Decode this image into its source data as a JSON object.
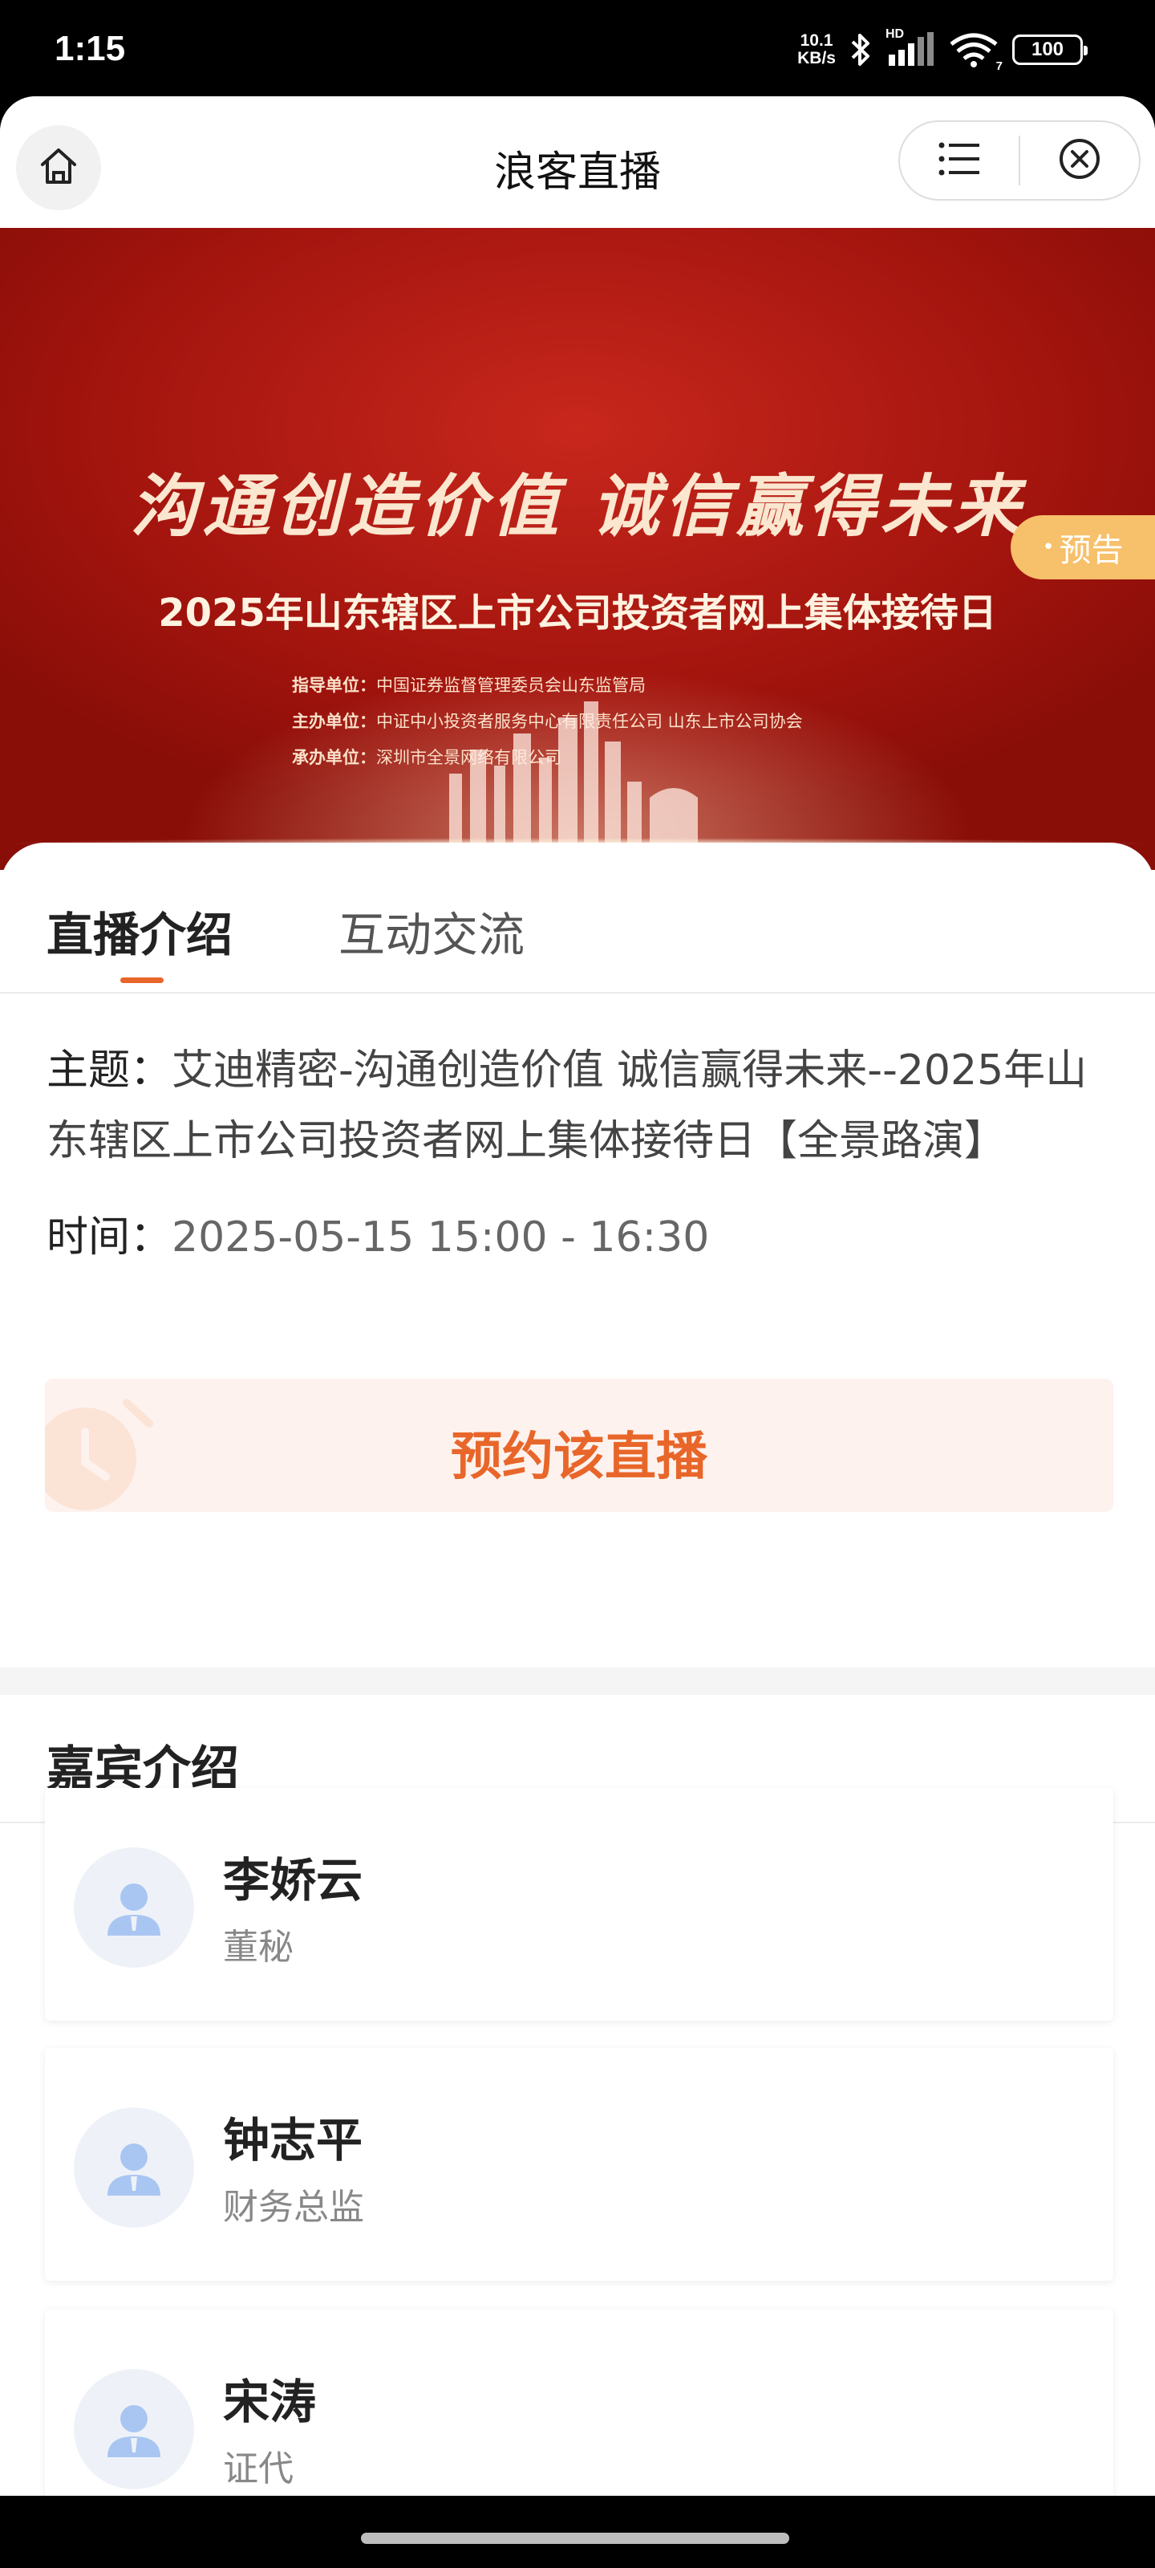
{
  "status_bar": {
    "time": "1:15",
    "netspeed_value": "10.1",
    "netspeed_unit": "KB/s",
    "hd_label": "HD",
    "wifi_sub": "7",
    "battery": "100"
  },
  "title_bar": {
    "title": "浪客直播"
  },
  "banner": {
    "slogan": "沟通创造价值  诚信赢得未来",
    "title": "2025年山东辖区上市公司投资者网上集体接待日",
    "units": [
      {
        "label": "指导单位：",
        "value": "中国证券监督管理委员会山东监管局"
      },
      {
        "label": "主办单位：",
        "value": "中证中小投资者服务中心有限责任公司   山东上市公司协会"
      },
      {
        "label": "承办单位：",
        "value": "深圳市全景网络有限公司"
      }
    ],
    "tag": "预告",
    "tag_color": "#f7c06a"
  },
  "tabs": [
    {
      "label": "直播介绍",
      "active": true
    },
    {
      "label": "互动交流",
      "active": false
    }
  ],
  "intro": {
    "topic_label": "主题：",
    "topic_value": "艾迪精密-沟通创造价值 诚信赢得未来--2025年山东辖区上市公司投资者网上集体接待日【全景路演】",
    "time_label": "时间：",
    "time_value": "2025-05-15 15:00 - 16:30",
    "reserve_label": "预约该直播"
  },
  "guests": {
    "title": "嘉宾介绍",
    "items": [
      {
        "name": "李娇云",
        "role": "董秘"
      },
      {
        "name": "钟志平",
        "role": "财务总监"
      },
      {
        "name": "宋涛",
        "role": "证代"
      }
    ]
  },
  "colors": {
    "accent": "#e8662a",
    "reserve_bg": "#fdf2ee",
    "banner_red": "#b01a12"
  }
}
